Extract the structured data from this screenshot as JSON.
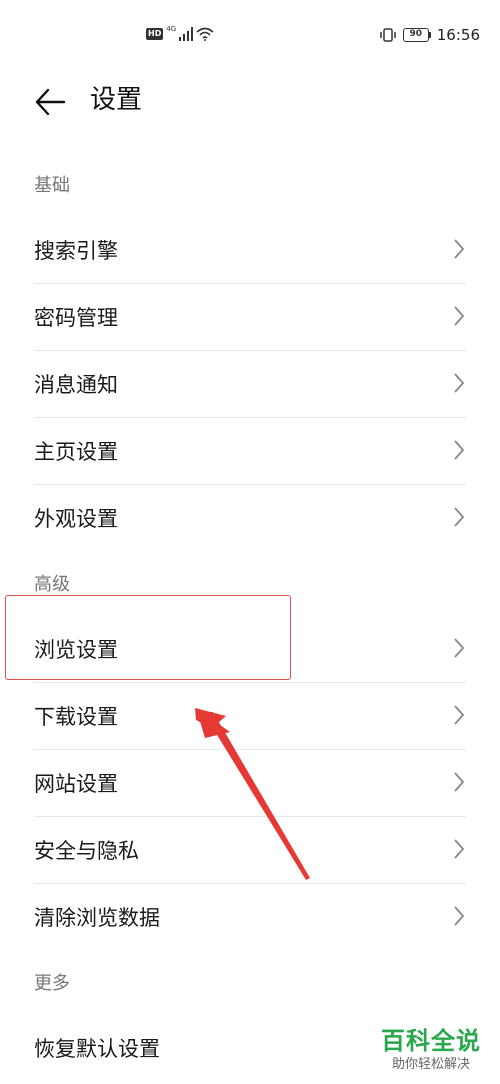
{
  "status_bar": {
    "network_badge": "HD",
    "network_type": "4G",
    "battery": "90",
    "time": "16:56"
  },
  "header": {
    "back_icon": "arrow-left-icon",
    "title": "设置"
  },
  "sections": [
    {
      "label": "基础",
      "items": [
        "搜索引擎",
        "密码管理",
        "消息通知",
        "主页设置",
        "外观设置"
      ]
    },
    {
      "label": "高级",
      "items": [
        "浏览设置",
        "下载设置",
        "网站设置",
        "安全与隐私",
        "清除浏览数据"
      ]
    },
    {
      "label": "更多",
      "items": [
        "恢复默认设置"
      ]
    }
  ],
  "annotation": {
    "highlight_color": "#d9534f",
    "arrow_color": "#e53935"
  },
  "watermark": {
    "title": "百科全说",
    "subtitle": "助你轻松解决"
  }
}
